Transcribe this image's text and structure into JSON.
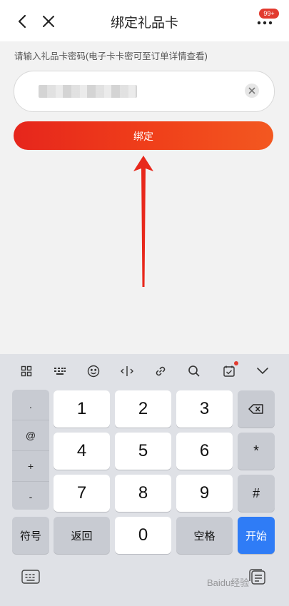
{
  "header": {
    "title": "绑定礼品卡",
    "badge": "99+"
  },
  "form": {
    "prompt": "请输入礼品卡密码(电子卡卡密可至订单详情查看)",
    "bind_label": "绑定"
  },
  "keyboard": {
    "toolbar_icons": [
      "grid-icon",
      "keyboard-icon",
      "emoji-icon",
      "cursor-icon",
      "link-icon",
      "search-icon",
      "clipboard-icon",
      "collapse-icon"
    ],
    "symbols": [
      ".",
      "@",
      "+",
      "-"
    ],
    "digits": [
      "1",
      "2",
      "3",
      "4",
      "5",
      "6",
      "7",
      "8",
      "9",
      "0"
    ],
    "star": "*",
    "hash": "#",
    "symbols_label": "符号",
    "back_label": "返回",
    "space_label": "空格",
    "go_label": "开始"
  },
  "watermark": "Baidu经验",
  "colors": {
    "accent_red": "#e6261c",
    "keyboard_blue": "#2f7cf6",
    "badge_red": "#e23a2e"
  }
}
